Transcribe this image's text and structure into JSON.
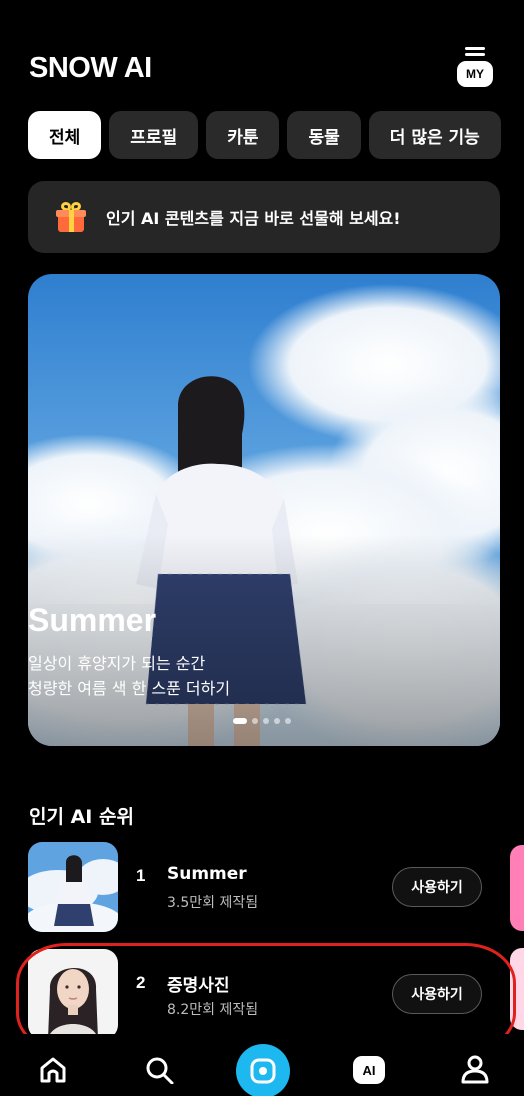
{
  "header": {
    "title": "SNOW AI",
    "my_label": "MY"
  },
  "tabs": [
    {
      "label": "전체",
      "active": true
    },
    {
      "label": "프로필",
      "active": false
    },
    {
      "label": "카툰",
      "active": false
    },
    {
      "label": "동물",
      "active": false
    },
    {
      "label": "더 많은 기능",
      "active": false
    }
  ],
  "promo": {
    "icon": "gift-icon",
    "text": "인기 AI 콘텐츠를 지금 바로 선물해 보세요!"
  },
  "hero": {
    "title": "Summer",
    "subtitle_line1": "일상이 휴양지가 되는 순간",
    "subtitle_line2": "청량한 여름 색 한 스푼 더하기",
    "page_count": 5,
    "active_page": 1
  },
  "ranking": {
    "title": "인기 AI 순위",
    "items": [
      {
        "rank": "1",
        "name": "Summer",
        "count": "3.5만회 제작됨",
        "button": "사용하기"
      },
      {
        "rank": "2",
        "name": "증명사진",
        "count": "8.2만회 제작됨",
        "button": "사용하기"
      }
    ]
  },
  "bottom_nav": {
    "items": [
      "home-icon",
      "search-icon",
      "camera-icon",
      "ai-icon",
      "profile-icon"
    ],
    "ai_label": "AI",
    "accent": "#1db8ef"
  },
  "colors": {
    "background": "#000000",
    "highlight": "#e0221e",
    "card": "#262626"
  }
}
